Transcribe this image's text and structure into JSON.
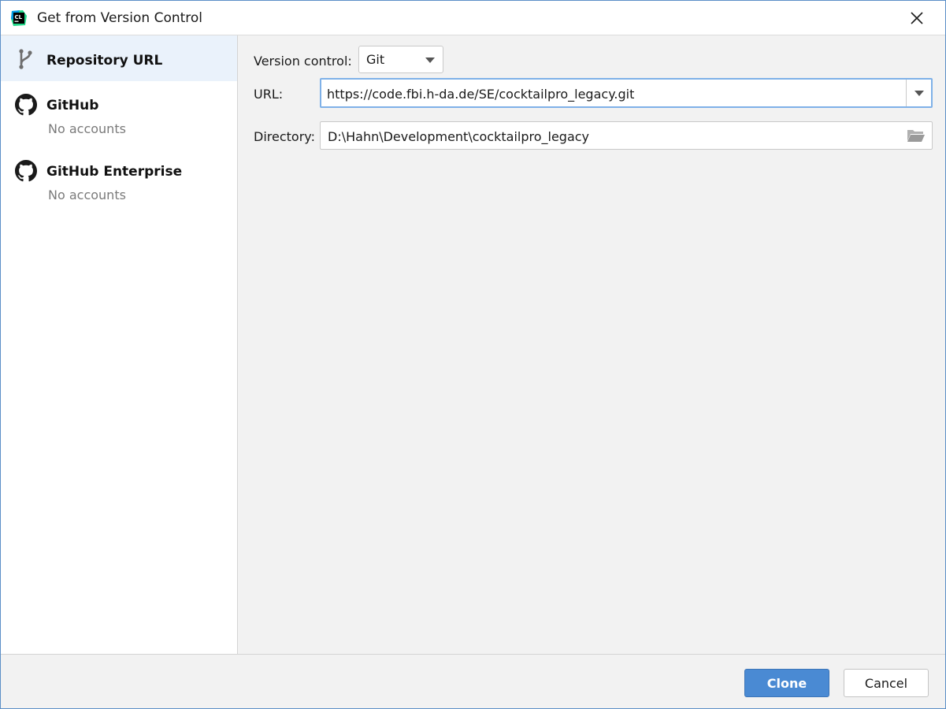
{
  "window": {
    "title": "Get from Version Control",
    "app_icon": "clion-app-icon",
    "app_icon_text": "CL"
  },
  "sidebar": {
    "items": [
      {
        "title": "Repository URL",
        "subtitle": "",
        "icon": "vcs-branch-icon",
        "selected": true
      },
      {
        "title": "GitHub",
        "subtitle": "No accounts",
        "icon": "github-icon",
        "selected": false
      },
      {
        "title": "GitHub Enterprise",
        "subtitle": "No accounts",
        "icon": "github-icon",
        "selected": false
      }
    ]
  },
  "form": {
    "version_control_label": "Version control:",
    "version_control_value": "Git",
    "url_label": "URL:",
    "url_value": "https://code.fbi.h-da.de/SE/cocktailpro_legacy.git",
    "directory_label": "Directory:",
    "directory_value": "D:\\Hahn\\Development\\cocktailpro_legacy"
  },
  "footer": {
    "clone_label": "Clone",
    "cancel_label": "Cancel"
  },
  "colors": {
    "accent": "#4a8ad3",
    "focus_border": "#7fb1e8",
    "selected_bg": "#eaf2fb"
  }
}
